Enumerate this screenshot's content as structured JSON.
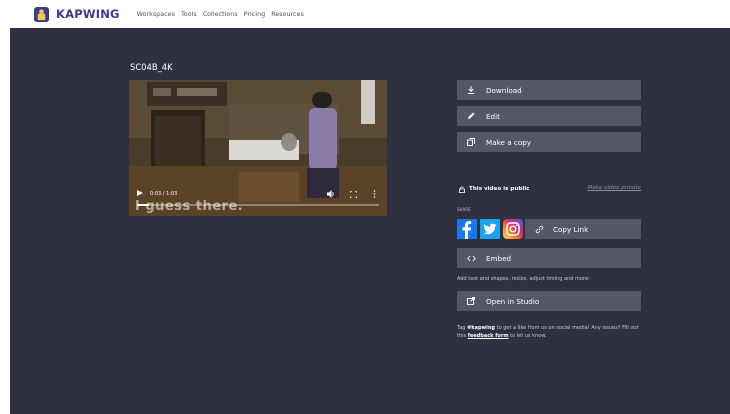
{
  "brand": {
    "name": "KAPWING"
  },
  "nav": {
    "items": [
      "Workspaces",
      "Tools",
      "Collections",
      "Pricing",
      "Resources"
    ]
  },
  "video": {
    "title": "SC04B_4K",
    "caption": "I guess there.",
    "time": "0:03 / 1:03",
    "progress": 0.048
  },
  "actions": {
    "download": "Download",
    "edit": "Edit",
    "make_copy": "Make a copy",
    "public_status": "This video is public",
    "make_private": "Make video private",
    "share_label": "SHARE",
    "copy_link": "Copy Link",
    "embed": "Embed",
    "studio_note": "Add text and shapes, resize, adjust timing and more:",
    "open_studio": "Open in Studio"
  },
  "footer": {
    "tag_before": "Tag ",
    "tag_handle": "#kapwing",
    "tag_after": " to get a like from us on social media! Any issues? Fill out this ",
    "feedback_link": "feedback form",
    "tag_end": " to let us know."
  },
  "colors": {
    "brand": "#3a3c8f",
    "background": "#2f3140",
    "button": "#555766",
    "facebook": "#1877f2",
    "twitter": "#1da1f2"
  }
}
